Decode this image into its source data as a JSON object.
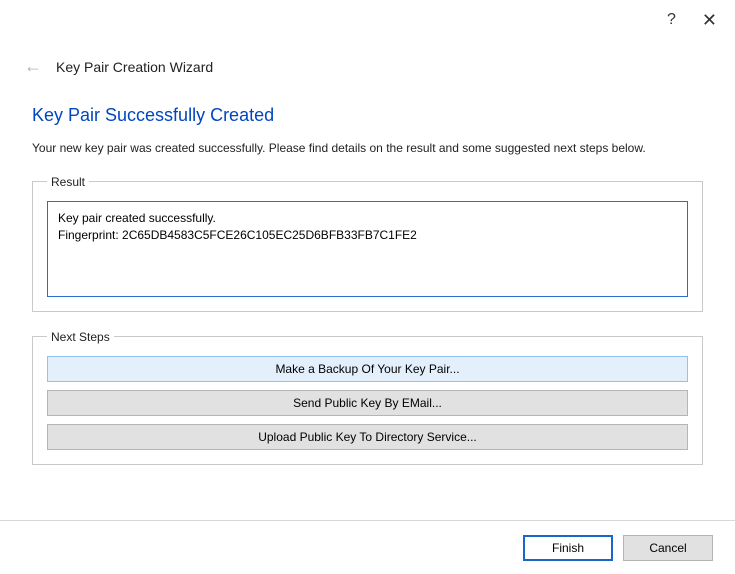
{
  "titlebar": {
    "help_glyph": "?",
    "close_glyph": "✕"
  },
  "header": {
    "back_glyph": "←",
    "wizard_title": "Key Pair Creation Wizard"
  },
  "main": {
    "heading": "Key Pair Successfully Created",
    "description": "Your new key pair was created successfully. Please find details on the result and some suggested next steps below."
  },
  "result": {
    "legend": "Result",
    "text": "Key pair created successfully.\nFingerprint: 2C65DB4583C5FCE26C105EC25D6BFB33FB7C1FE2"
  },
  "next_steps": {
    "legend": "Next Steps",
    "backup_label": "Make a Backup Of Your Key Pair...",
    "email_label": "Send Public Key By EMail...",
    "upload_label": "Upload Public Key To Directory Service..."
  },
  "footer": {
    "finish_label": "Finish",
    "cancel_label": "Cancel"
  }
}
